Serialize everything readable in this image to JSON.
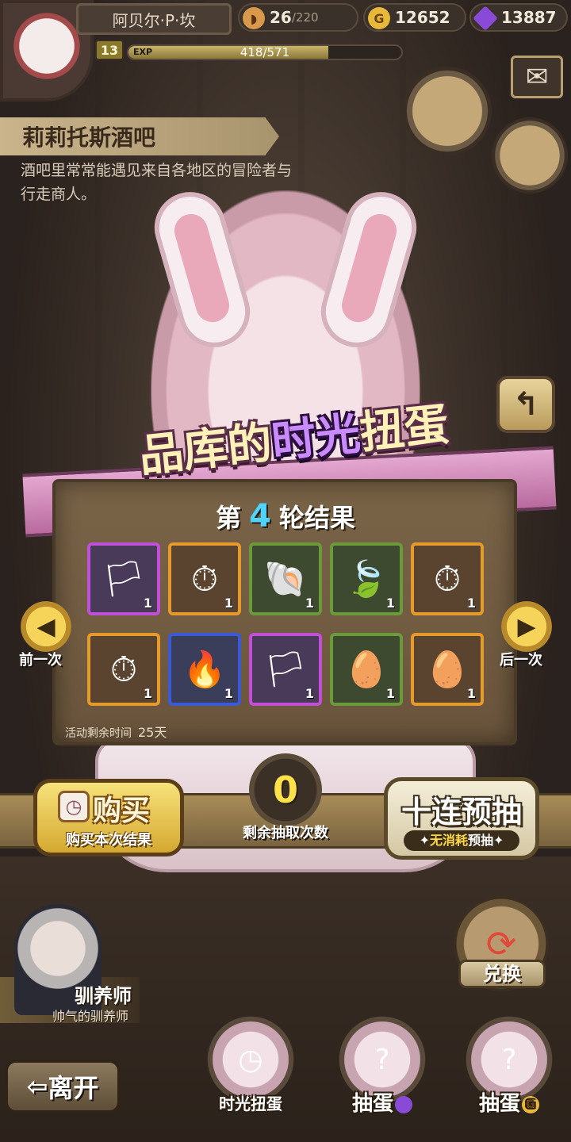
{
  "player": {
    "name": "阿贝尔·P·坎",
    "level": "13",
    "exp_label": "EXP",
    "exp_value": "418/571",
    "exp_fraction": 0.732
  },
  "resources": {
    "stamina": "26",
    "stamina_max": "/220",
    "gold": "12652",
    "gems": "13887",
    "gold_icon": "G"
  },
  "location": {
    "title": "莉莉托斯酒吧",
    "description": "酒吧里常常能遇见来自各地区的冒险者与行走商人。"
  },
  "banner": {
    "title_pre": "品库的",
    "title_highlight": "时光",
    "title_post": "扭蛋"
  },
  "results": {
    "round_prefix": "第",
    "round_number": "4",
    "round_suffix": "轮结果",
    "items": [
      {
        "name": "蓝色旗帜",
        "rarity": "purple",
        "icon": "🏳",
        "qty": "1"
      },
      {
        "name": "怀表",
        "rarity": "orange",
        "icon": "⏱",
        "qty": "1"
      },
      {
        "name": "贝壳",
        "rarity": "green",
        "icon": "🐚",
        "qty": "1"
      },
      {
        "name": "叶子",
        "rarity": "green",
        "icon": "🍃",
        "qty": "1"
      },
      {
        "name": "怀表",
        "rarity": "orange",
        "icon": "⏱",
        "qty": "1"
      },
      {
        "name": "怀表",
        "rarity": "orange",
        "icon": "⏱",
        "qty": "1"
      },
      {
        "name": "火焰",
        "rarity": "blue",
        "icon": "🔥",
        "qty": "1"
      },
      {
        "name": "蓝色旗帜",
        "rarity": "purple",
        "icon": "🏳",
        "qty": "1"
      },
      {
        "name": "龟壳",
        "rarity": "green",
        "icon": "🥚",
        "qty": "1"
      },
      {
        "name": "金蛋",
        "rarity": "orange",
        "icon": "🥚",
        "qty": "1"
      }
    ],
    "time_label": "活动剩余时间",
    "time_value": "25天"
  },
  "nav": {
    "prev_label": "前一次",
    "next_label": "后一次"
  },
  "actions": {
    "buy_main": "购买",
    "buy_sub": "购买本次结果",
    "draws_remaining": "0",
    "draws_label": "剩余抽取次数",
    "ten_main": "十连预抽",
    "ten_sub_accent": "无消耗",
    "ten_sub_rest": "预抽"
  },
  "trainer": {
    "name": "驯养师",
    "subtitle": "帅气的驯养师"
  },
  "exchange_label": "兑换",
  "bottom": {
    "leave_label": "离开",
    "tab_time_gacha": "时光扭蛋",
    "tab_draw_gem": "抽蛋",
    "tab_draw_gold": "抽蛋"
  },
  "colors": {
    "gem": "#8a4ad8",
    "gold": "#e8b83a",
    "round_number": "#4fd4ff",
    "draw_counter": "#ffe24a"
  }
}
